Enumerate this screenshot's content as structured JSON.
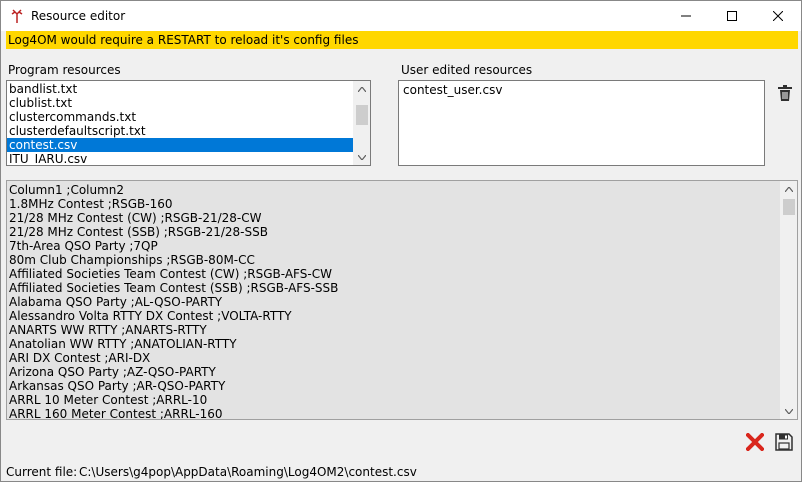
{
  "window": {
    "title": "Resource editor"
  },
  "warning": {
    "text": "Log4OM would require a RESTART to reload it's config files"
  },
  "program_resources": {
    "label": "Program resources",
    "items": [
      "bandlist.txt",
      "clublist.txt",
      "clustercommands.txt",
      "clusterdefaultscript.txt",
      "contest.csv",
      "ITU_IARU.csv"
    ],
    "selected_index": 4
  },
  "user_resources": {
    "label": "User edited resources",
    "items": [
      "contest_user.csv"
    ]
  },
  "content": {
    "lines": [
      "Column1 ;Column2",
      "1.8MHz Contest ;RSGB-160",
      "21/28 MHz Contest (CW) ;RSGB-21/28-CW",
      "21/28 MHz Contest (SSB) ;RSGB-21/28-SSB",
      "7th-Area QSO Party ;7QP",
      "80m Club Championships ;RSGB-80M-CC",
      "Affiliated Societies Team Contest (CW) ;RSGB-AFS-CW",
      "Affiliated Societies Team Contest (SSB) ;RSGB-AFS-SSB",
      "Alabama QSO Party ;AL-QSO-PARTY",
      "Alessandro Volta RTTY DX Contest ;VOLTA-RTTY",
      "ANARTS WW RTTY ;ANARTS-RTTY",
      "Anatolian WW RTTY ;ANATOLIAN-RTTY",
      "ARI DX Contest ;ARI-DX",
      "Arizona QSO Party ;AZ-QSO-PARTY",
      "Arkansas QSO Party ;AR-QSO-PARTY",
      "ARRL 10 Meter Contest ;ARRL-10",
      "ARRL 160 Meter Contest ;ARRL-160"
    ]
  },
  "status": {
    "label": "Current file:",
    "path": "C:\\Users\\g4pop\\AppData\\Roaming\\Log4OM2\\contest.csv"
  },
  "icons": {
    "app": "antenna-icon",
    "delete": "trash-icon",
    "cancel": "red-x-icon",
    "save": "floppy-disk-icon"
  },
  "colors": {
    "warning_bg": "#ffd700",
    "selection": "#0078d7",
    "cancel_red": "#d9261c"
  }
}
